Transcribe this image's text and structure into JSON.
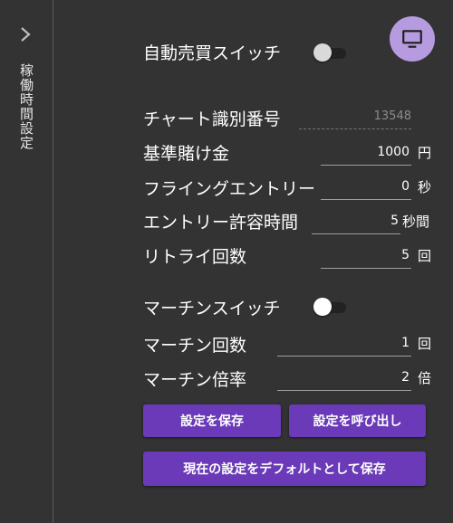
{
  "sidebar": {
    "vertical_title": "稼働時間設定",
    "expand_icon": "chevron-right-icon"
  },
  "fab": {
    "icon": "monitor-icon",
    "color": "#b79be0"
  },
  "auto_switch": {
    "label": "自動売買スイッチ",
    "on": false
  },
  "chart_id": {
    "label": "チャート識別番号",
    "placeholder": "13548"
  },
  "base_bet": {
    "label": "基準賭け金",
    "value": "1000",
    "unit": "円"
  },
  "flying_entry": {
    "label": "フライングエントリー",
    "value": "0",
    "unit": "秒"
  },
  "entry_allow": {
    "label": "エントリー許容時間",
    "value": "5",
    "unit": "秒間"
  },
  "retry": {
    "label": "リトライ回数",
    "value": "5",
    "unit": "回"
  },
  "martin_switch": {
    "label": "マーチンスイッチ",
    "on": false
  },
  "martin_count": {
    "label": "マーチン回数",
    "value": "1",
    "unit": "回"
  },
  "martin_rate": {
    "label": "マーチン倍率",
    "value": "2",
    "unit": "倍"
  },
  "buttons": {
    "save": "設定を保存",
    "load": "設定を呼び出し",
    "save_default": "現在の設定をデフォルトとして保存"
  },
  "colors": {
    "accent": "#6a3ab8",
    "background": "#333333"
  }
}
